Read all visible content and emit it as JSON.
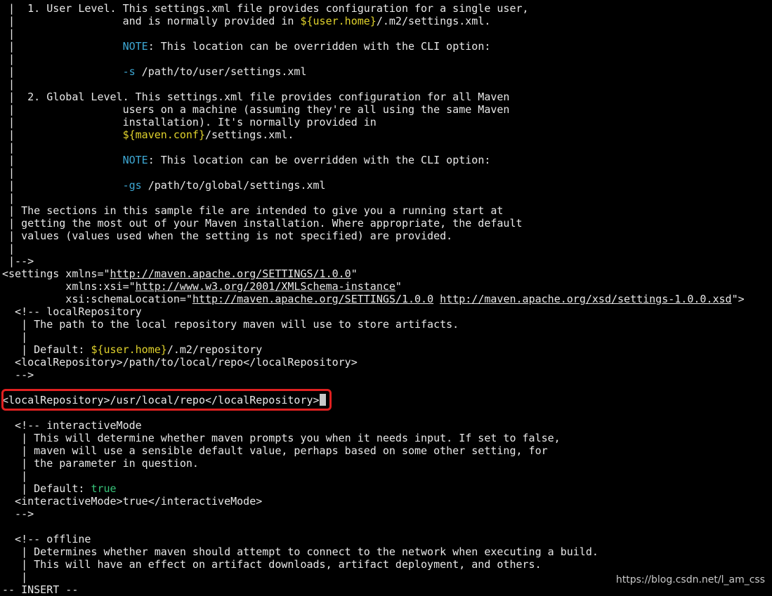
{
  "terminal": {
    "mode_line": "-- INSERT --",
    "watermark": "https://blog.csdn.net/l_am_css",
    "colors": {
      "background": "#000000",
      "text": "#e8e8e8",
      "variable": "#e0d22c",
      "keyword": "#3ea8d4",
      "boolean": "#37c47a",
      "highlight_box": "#e02020"
    },
    "lines": [
      [
        {
          "t": " |  1. User Level. This settings.xml file provides configuration for a single user,",
          "c": "normal"
        }
      ],
      [
        {
          "t": " |                 and is normally provided in ",
          "c": "normal"
        },
        {
          "t": "${user.home}",
          "c": "var"
        },
        {
          "t": "/.m2/settings.xml.",
          "c": "normal"
        }
      ],
      [
        {
          "t": " |",
          "c": "normal"
        }
      ],
      [
        {
          "t": " |                 ",
          "c": "normal"
        },
        {
          "t": "NOTE",
          "c": "keyword"
        },
        {
          "t": ": This location can be overridden with the CLI option:",
          "c": "normal"
        }
      ],
      [
        {
          "t": " |",
          "c": "normal"
        }
      ],
      [
        {
          "t": " |                 ",
          "c": "normal"
        },
        {
          "t": "-s",
          "c": "keyword"
        },
        {
          "t": " /path/to/user/settings.xml",
          "c": "normal"
        }
      ],
      [
        {
          "t": " |",
          "c": "normal"
        }
      ],
      [
        {
          "t": " |  2. Global Level. This settings.xml file provides configuration for all Maven",
          "c": "normal"
        }
      ],
      [
        {
          "t": " |                 users on a machine (assuming they're all using the same Maven",
          "c": "normal"
        }
      ],
      [
        {
          "t": " |                 installation). It's normally provided in",
          "c": "normal"
        }
      ],
      [
        {
          "t": " |                 ",
          "c": "normal"
        },
        {
          "t": "${maven.conf}",
          "c": "var"
        },
        {
          "t": "/settings.xml.",
          "c": "normal"
        }
      ],
      [
        {
          "t": " |",
          "c": "normal"
        }
      ],
      [
        {
          "t": " |                 ",
          "c": "normal"
        },
        {
          "t": "NOTE",
          "c": "keyword"
        },
        {
          "t": ": This location can be overridden with the CLI option:",
          "c": "normal"
        }
      ],
      [
        {
          "t": " |",
          "c": "normal"
        }
      ],
      [
        {
          "t": " |                 ",
          "c": "normal"
        },
        {
          "t": "-gs",
          "c": "keyword"
        },
        {
          "t": " /path/to/global/settings.xml",
          "c": "normal"
        }
      ],
      [
        {
          "t": " |",
          "c": "normal"
        }
      ],
      [
        {
          "t": " | The sections in this sample file are intended to give you a running start at",
          "c": "normal"
        }
      ],
      [
        {
          "t": " | getting the most out of your Maven installation. Where appropriate, the default",
          "c": "normal"
        }
      ],
      [
        {
          "t": " | values (values used when the setting is not specified) are provided.",
          "c": "normal"
        }
      ],
      [
        {
          "t": " |",
          "c": "normal"
        }
      ],
      [
        {
          "t": " |-->",
          "c": "normal"
        }
      ],
      [
        {
          "t": "<settings xmlns=\"",
          "c": "normal"
        },
        {
          "t": "http://maven.apache.org/SETTINGS/1.0.0",
          "c": "url"
        },
        {
          "t": "\"",
          "c": "normal"
        }
      ],
      [
        {
          "t": "          xmlns:xsi=\"",
          "c": "normal"
        },
        {
          "t": "http://www.w3.org/2001/XMLSchema-instance",
          "c": "url"
        },
        {
          "t": "\"",
          "c": "normal"
        }
      ],
      [
        {
          "t": "          xsi:schemaLocation=\"",
          "c": "normal"
        },
        {
          "t": "http://maven.apache.org/SETTINGS/1.0.0",
          "c": "url"
        },
        {
          "t": " ",
          "c": "normal"
        },
        {
          "t": "http://maven.apache.org/xsd/settings-1.0.0.xsd",
          "c": "url"
        },
        {
          "t": "\">",
          "c": "normal"
        }
      ],
      [
        {
          "t": "  <!-- localRepository",
          "c": "normal"
        }
      ],
      [
        {
          "t": "   | The path to the local repository maven will use to store artifacts.",
          "c": "normal"
        }
      ],
      [
        {
          "t": "   |",
          "c": "normal"
        }
      ],
      [
        {
          "t": "   | Default: ",
          "c": "normal"
        },
        {
          "t": "${user.home}",
          "c": "var"
        },
        {
          "t": "/.m2/repository",
          "c": "normal"
        }
      ],
      [
        {
          "t": "  <localRepository>/path/to/local/repo</localRepository>",
          "c": "normal"
        }
      ],
      [
        {
          "t": "  -->",
          "c": "normal"
        }
      ],
      [
        {
          "t": "",
          "c": "normal"
        }
      ],
      [
        {
          "t": "<localRepository>/usr/local/repo</localRepository>",
          "c": "normal"
        },
        {
          "t": " ",
          "c": "cursor"
        }
      ],
      [
        {
          "t": "",
          "c": "normal"
        }
      ],
      [
        {
          "t": "  <!-- interactiveMode",
          "c": "normal"
        }
      ],
      [
        {
          "t": "   | This will determine whether maven prompts you when it needs input. If set to false,",
          "c": "normal"
        }
      ],
      [
        {
          "t": "   | maven will use a sensible default value, perhaps based on some other setting, for",
          "c": "normal"
        }
      ],
      [
        {
          "t": "   | the parameter in question.",
          "c": "normal"
        }
      ],
      [
        {
          "t": "   |",
          "c": "normal"
        }
      ],
      [
        {
          "t": "   | Default: ",
          "c": "normal"
        },
        {
          "t": "true",
          "c": "bool"
        }
      ],
      [
        {
          "t": "  <interactiveMode>true</interactiveMode>",
          "c": "normal"
        }
      ],
      [
        {
          "t": "  -->",
          "c": "normal"
        }
      ],
      [
        {
          "t": "",
          "c": "normal"
        }
      ],
      [
        {
          "t": "  <!-- offline",
          "c": "normal"
        }
      ],
      [
        {
          "t": "   | Determines whether maven should attempt to connect to the network when executing a build.",
          "c": "normal"
        }
      ],
      [
        {
          "t": "   | This will have an effect on artifact downloads, artifact deployment, and others.",
          "c": "normal"
        }
      ],
      [
        {
          "t": "   |",
          "c": "normal"
        }
      ]
    ]
  }
}
